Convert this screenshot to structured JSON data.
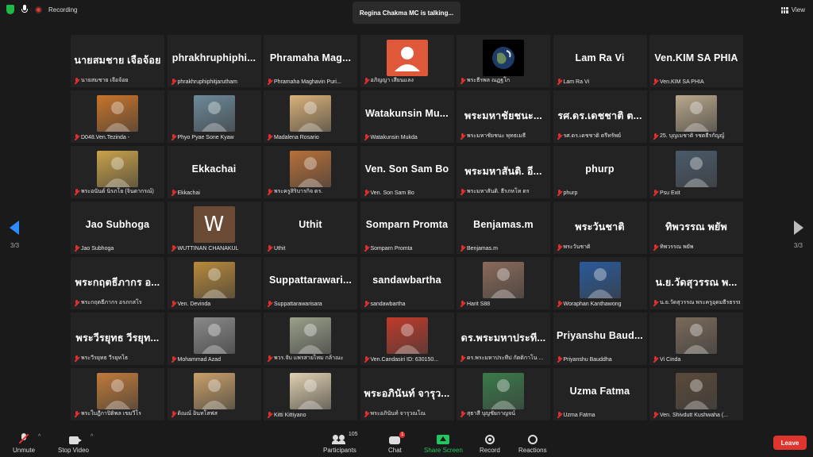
{
  "topbar": {
    "recording_label": "Recording",
    "talking": "Regina Chakma MC is talking...",
    "view_label": "View"
  },
  "pagination": {
    "left": "3/3",
    "right": "3/3"
  },
  "tiles": [
    {
      "display": "นายสมชาย เจือจ้อย",
      "caption": "นายสมชาย เจือจ้อย"
    },
    {
      "display": "phrakhruphiphi...",
      "caption": "phrakhruphiphitjarutham"
    },
    {
      "display": "Phramaha Mag...",
      "caption": "Phramaha Maghavin Puri..."
    },
    {
      "avatar": {
        "kind": "default",
        "color": "#e0583a"
      },
      "caption": "อภิญญา เสียนแลง"
    },
    {
      "avatar": {
        "kind": "earth",
        "color": "#1d3b66"
      },
      "caption": "พระธีรพล ณฏฐโก"
    },
    {
      "display": "Lam Ra Vi",
      "caption": "Lam Ra Vi"
    },
    {
      "display": "Ven.KIM SA PHIA",
      "caption": "Ven.KIM SA PHIA"
    },
    {
      "avatar": {
        "kind": "photo",
        "color": "#c8742a"
      },
      "caption": "D048.Ven.Tezinda -"
    },
    {
      "avatar": {
        "kind": "photo",
        "color": "#6d8a9a"
      },
      "caption": "Phyo Pyae Sone Kyaw"
    },
    {
      "avatar": {
        "kind": "photo",
        "color": "#d9b27a"
      },
      "caption": "Madalena Rosario"
    },
    {
      "display": "Watakunsin Mu...",
      "caption": "Watakunsin Mukda"
    },
    {
      "display": "พระมหาชัยชนะ...",
      "caption": "พระมหาชัยชนะ พุทธเมธี"
    },
    {
      "display": "รศ.ดร.เดชชาติ ต...",
      "caption": "รศ.ดร.เดชชาติ ตรีทรัพย์"
    },
    {
      "avatar": {
        "kind": "photo",
        "color": "#b9a88c"
      },
      "caption": "25. บุญเมชาติ รชตธีรกัญญ์"
    },
    {
      "avatar": {
        "kind": "photo",
        "color": "#c9a24a"
      },
      "caption": "พระอนันต์ นิรภโย (จินดากรณ์)"
    },
    {
      "display": "Ekkachai",
      "caption": "Ekkachai"
    },
    {
      "avatar": {
        "kind": "photo",
        "color": "#b8703a"
      },
      "caption": "พระครูสิริบารกิจ ดร."
    },
    {
      "display": "Ven. Son Sam Bo",
      "caption": "Ven. Son Sam Bo"
    },
    {
      "display": "พระมหาสันติ. อี...",
      "caption": "พระมหาสันติ. ธีรภหโห ดร"
    },
    {
      "display": "phurp",
      "caption": "phurp"
    },
    {
      "avatar": {
        "kind": "photo",
        "color": "#4a5a6a"
      },
      "caption": "Psu Exit"
    },
    {
      "display": "Jao Subhoga",
      "caption": "Jao Subhoga"
    },
    {
      "avatar": {
        "kind": "letter",
        "letter": "W",
        "color": "#6b4a36"
      },
      "caption": "WUTTINAN CHANAKUL"
    },
    {
      "display": "Uthit",
      "caption": "Uthit"
    },
    {
      "display": "Somparn Promta",
      "caption": "Somparn Promta"
    },
    {
      "display": "Benjamas.m",
      "caption": "Benjamas.m"
    },
    {
      "display": "พระวันชาติ",
      "caption": "พระวันชาติ"
    },
    {
      "display": "ทิพวรรณ พยัพ",
      "caption": "ทิพวรรณ พยัพ"
    },
    {
      "display": "พระกฤตธีภากร อ...",
      "caption": "พระกฤตธีภากร อรภกสโร"
    },
    {
      "avatar": {
        "kind": "photo",
        "color": "#b88a3a"
      },
      "caption": "Ven. Devinda"
    },
    {
      "display": "Suppattarawari...",
      "caption": "Suppattarawarisara"
    },
    {
      "display": "sandawbartha",
      "caption": "sandawbartha"
    },
    {
      "avatar": {
        "kind": "photo",
        "color": "#8a6a5a"
      },
      "caption": "Harit S88"
    },
    {
      "avatar": {
        "kind": "photo",
        "color": "#2a5a9a"
      },
      "caption": "Woraphan Kanthawong"
    },
    {
      "display": "น.ย.วัดสุวรรณ พ...",
      "caption": "น.ย.วัดสุวรรณ พระครูอุดมธีรธรรมรา..."
    },
    {
      "display": "พระวีรยุทธ วีรยุท...",
      "caption": "พระวีรยุทธ วีรยุทโธ"
    },
    {
      "avatar": {
        "kind": "photo",
        "color": "#8a8a8a"
      },
      "caption": "Mohammad Azad"
    },
    {
      "avatar": {
        "kind": "photo",
        "color": "#9aa08a"
      },
      "caption": "พวร.จับ แพรสายไหม กล้าณะ"
    },
    {
      "avatar": {
        "kind": "photo",
        "color": "#c03a2a"
      },
      "caption": "Ven.Candasiri ID: 630150..."
    },
    {
      "display": "ดร.พระมหาประที...",
      "caption": "ดร.พระมหาประทีป กัตติกาโน ..."
    },
    {
      "display": "Priyanshu Baud...",
      "caption": "Priyanshu Bauddha"
    },
    {
      "avatar": {
        "kind": "photo",
        "color": "#7a6a5a"
      },
      "caption": "Vi Cinda"
    },
    {
      "avatar": {
        "kind": "photo",
        "color": "#c07a3a"
      },
      "caption": "พระใบฎีกาปิติพล เขมวีโร"
    },
    {
      "avatar": {
        "kind": "photo",
        "color": "#c8a06a"
      },
      "caption": "ดิณณ์ อินทโสฟส"
    },
    {
      "avatar": {
        "kind": "photo",
        "color": "#e0d0b0"
      },
      "caption": "Kitti Kittiyano"
    },
    {
      "display": "พระอภินันท์ จารุว...",
      "caption": "พระอภินันท์ จารุวณโณ"
    },
    {
      "avatar": {
        "kind": "photo",
        "color": "#3a7a4a"
      },
      "caption": "สุธาสี บุญชัยกาญจน์"
    },
    {
      "display": "Uzma Fatma",
      "caption": "Uzma Fatma"
    },
    {
      "avatar": {
        "kind": "photo",
        "color": "#5a4a3a"
      },
      "caption": "Ven. Shivdutt Kushwaha (..."
    }
  ],
  "toolbar": {
    "unmute": "Unmute",
    "stop_video": "Stop Video",
    "participants": "Participants",
    "participants_count": "105",
    "chat": "Chat",
    "chat_badge": "1",
    "share_screen": "Share Screen",
    "record": "Record",
    "reactions": "Reactions",
    "leave": "Leave"
  }
}
